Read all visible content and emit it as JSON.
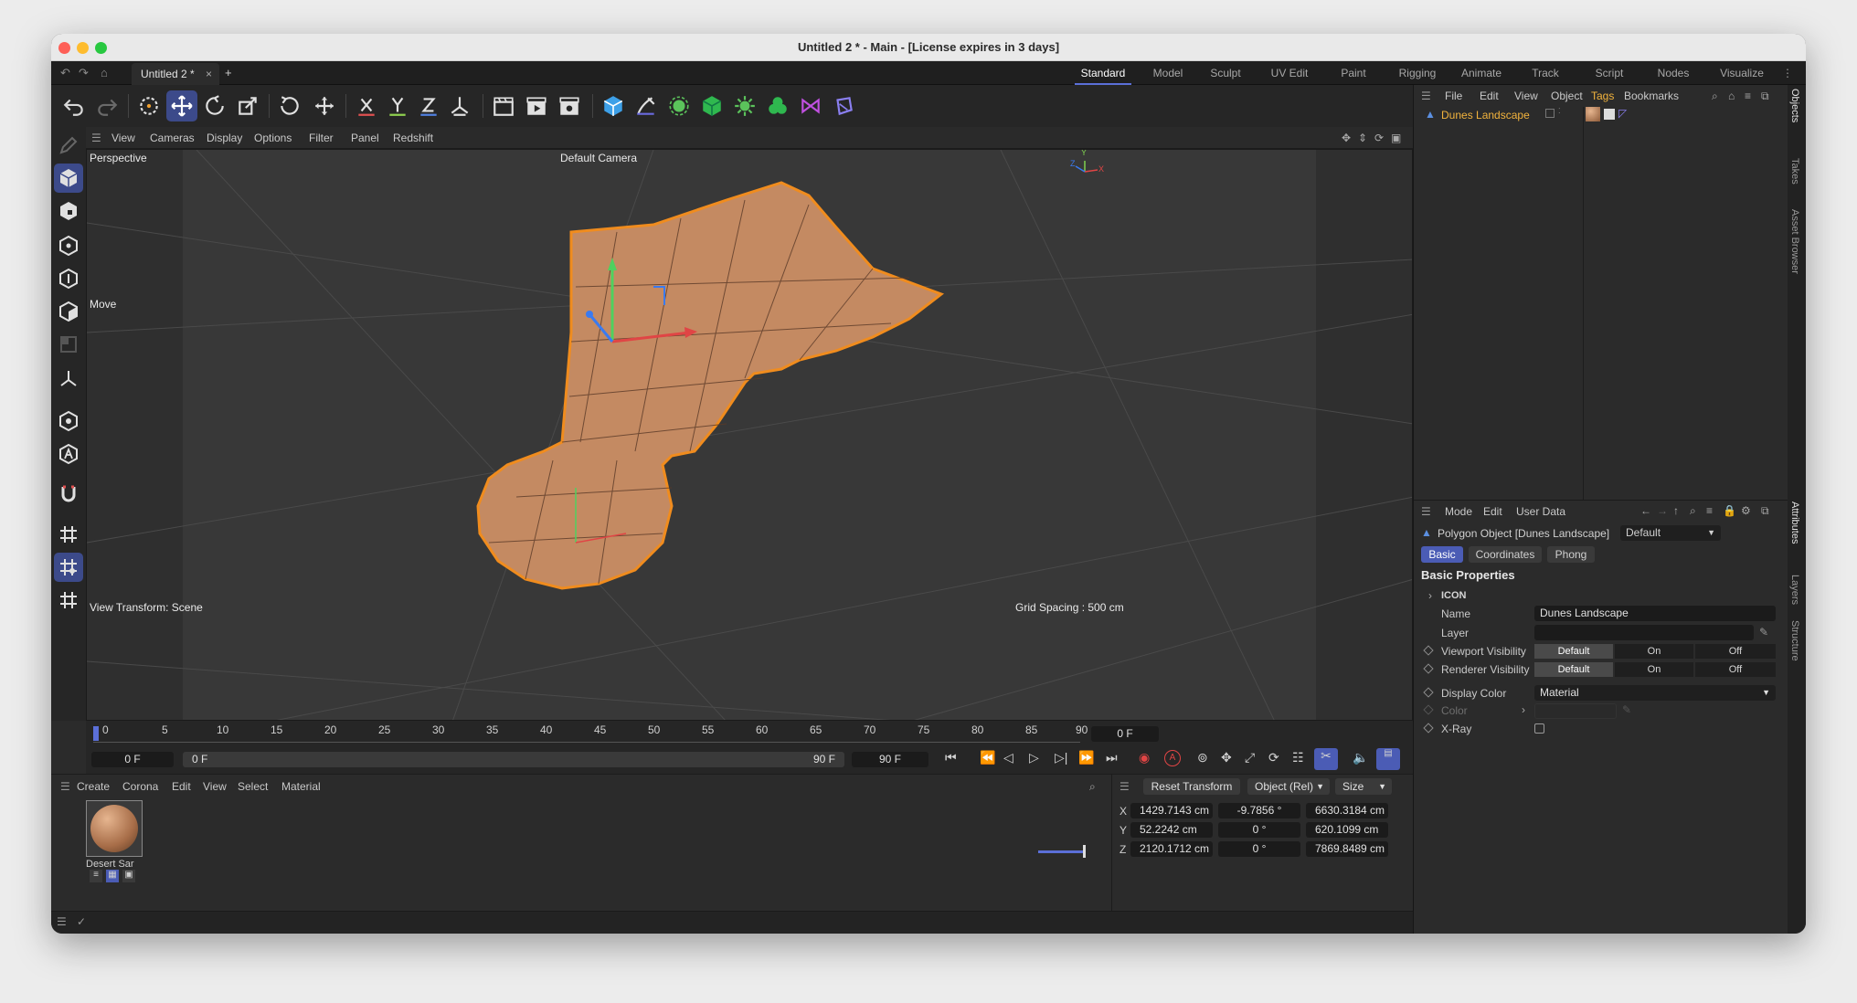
{
  "window": {
    "title": "Untitled 2 * - Main - [License expires in 3 days]"
  },
  "doc_tab": {
    "label": "Untitled 2 *",
    "close": "×",
    "add": "+"
  },
  "layouts": [
    "Standard",
    "Model",
    "Sculpt",
    "UV Edit",
    "Paint",
    "Rigging",
    "Animate",
    "Track",
    "Script",
    "Nodes",
    "Visualize"
  ],
  "viewport_menu": [
    "View",
    "Cameras",
    "Display",
    "Options",
    "Filter",
    "Panel",
    "Redshift"
  ],
  "viewport": {
    "projection": "Perspective",
    "camera": "Default Camera",
    "tool_label": "Move",
    "view_transform": "View Transform: Scene",
    "grid_spacing": "Grid Spacing : 500 cm",
    "axis_labels": {
      "x": "X",
      "y": "Y",
      "z": "Z"
    }
  },
  "timeline": {
    "ticks": [
      "0",
      "5",
      "10",
      "15",
      "20",
      "25",
      "30",
      "35",
      "40",
      "45",
      "50",
      "55",
      "60",
      "65",
      "70",
      "75",
      "80",
      "85",
      "90"
    ],
    "current_frame_display": "0 F",
    "start_field": "0 F",
    "range_start": "0 F",
    "range_end": "90 F",
    "end_field": "90 F",
    "auto_key_label": "A"
  },
  "materials": {
    "menu": [
      "Create",
      "Corona",
      "Edit",
      "View",
      "Select",
      "Material"
    ],
    "items": [
      {
        "name": "Desert Sar"
      }
    ]
  },
  "coords": {
    "reset_label": "Reset Transform",
    "mode_select": "Object (Rel)",
    "size_select": "Size",
    "rows": [
      {
        "axis": "X",
        "pos": "1429.7143 cm",
        "rot": "-9.7856 °",
        "size": "6630.3184 cm"
      },
      {
        "axis": "Y",
        "pos": "52.2242 cm",
        "rot": "0 °",
        "size": "620.1099 cm"
      },
      {
        "axis": "Z",
        "pos": "2120.1712 cm",
        "rot": "0 °",
        "size": "7869.8489 cm"
      }
    ]
  },
  "objects_panel": {
    "menu": [
      "File",
      "Edit",
      "View",
      "Object",
      "Tags",
      "Bookmarks"
    ],
    "active_menu": "Tags",
    "objects": [
      {
        "name": "Dunes Landscape"
      }
    ]
  },
  "attributes": {
    "menu": [
      "Mode",
      "Edit",
      "User Data"
    ],
    "object_title": "Polygon Object [Dunes Landscape]",
    "preset": "Default",
    "tabs": [
      "Basic",
      "Coordinates",
      "Phong"
    ],
    "section": "Basic Properties",
    "icon_group": "ICON",
    "name_label": "Name",
    "name_value": "Dunes Landscape",
    "layer_label": "Layer",
    "viewport_visibility": {
      "label": "Viewport Visibility",
      "options": [
        "Default",
        "On",
        "Off"
      ],
      "selected": "Default"
    },
    "renderer_visibility": {
      "label": "Renderer Visibility",
      "options": [
        "Default",
        "On",
        "Off"
      ],
      "selected": "Default"
    },
    "display_color": {
      "label": "Display Color",
      "value": "Material"
    },
    "color_label": "Color",
    "xray_label": "X-Ray"
  },
  "side_tabs": [
    "Objects",
    "Takes",
    "Asset Browser",
    "Attributes",
    "Layers",
    "Structure"
  ],
  "colors": {
    "accent": "#4b5cb5",
    "selection": "#f0a030",
    "terrain": "#c48a62",
    "object_name": "#f2b33d"
  }
}
